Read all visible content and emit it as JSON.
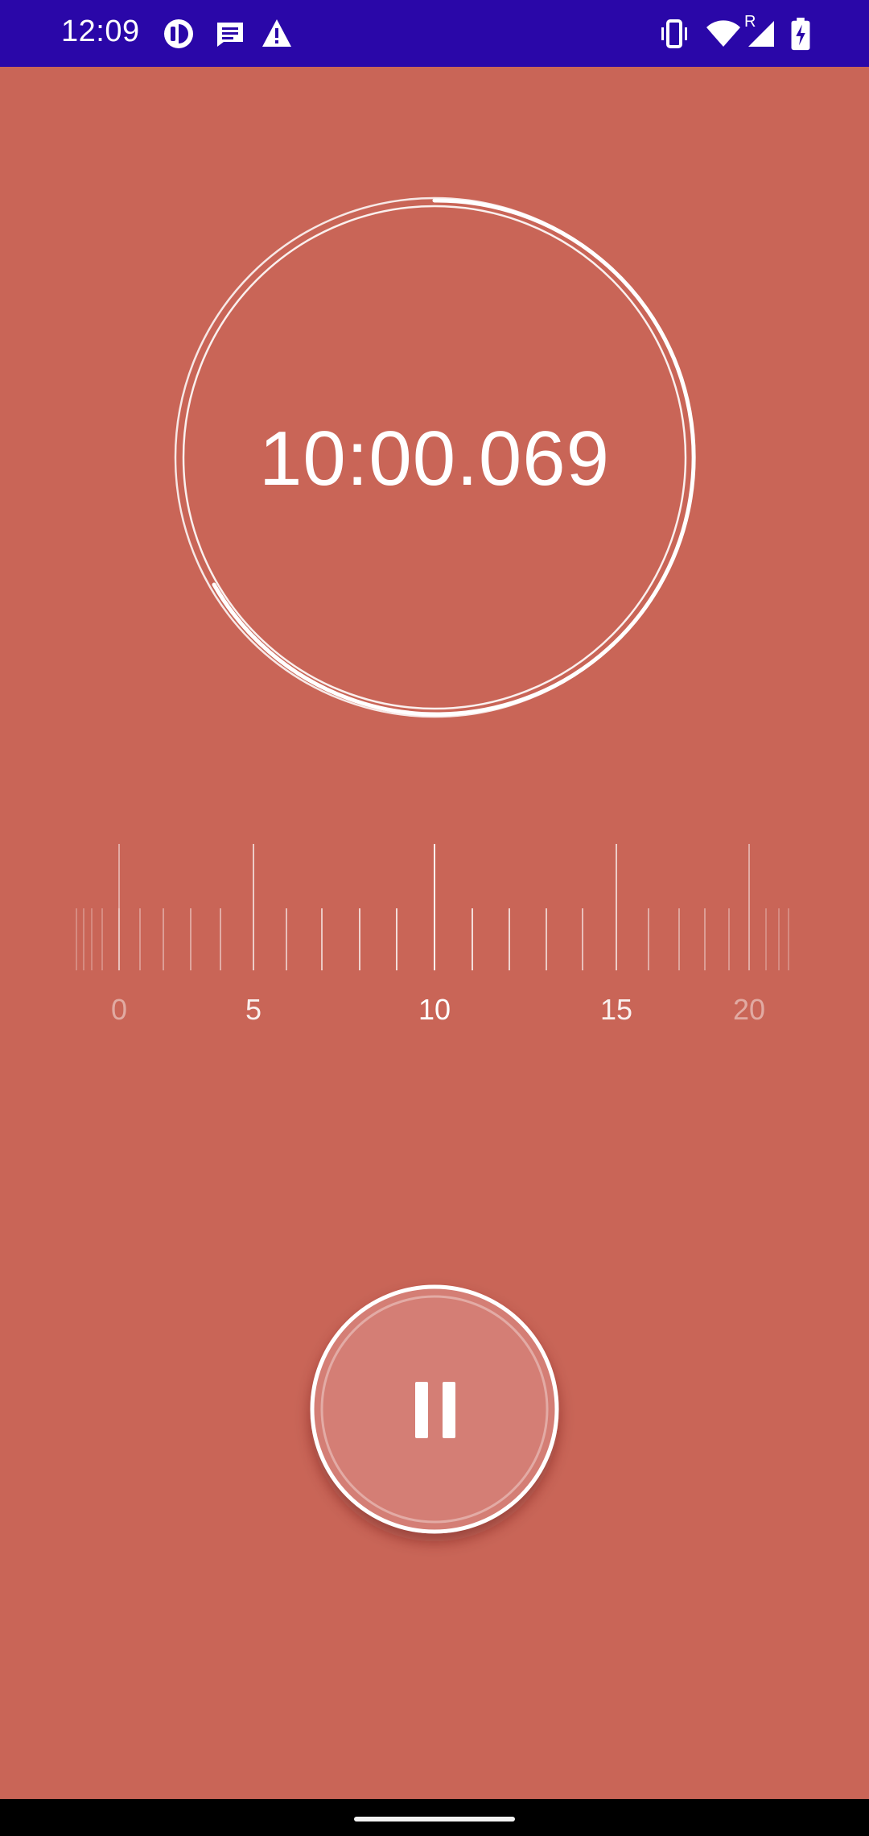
{
  "status_bar": {
    "time": "12:09",
    "background_color": "#2a07a8",
    "left_icons": [
      "notification-app-icon",
      "message-icon",
      "warning-icon"
    ],
    "right_icons": [
      "vibrate-icon",
      "wifi-icon",
      "cell-signal-icon",
      "battery-charging-icon"
    ],
    "roaming_label": "R"
  },
  "timer": {
    "readout": "10:00.069",
    "background_color": "#c96557"
  },
  "ruler": {
    "labels": [
      "0",
      "5",
      "10",
      "15",
      "20"
    ]
  },
  "controls": {
    "pause_icon": "pause-icon"
  }
}
